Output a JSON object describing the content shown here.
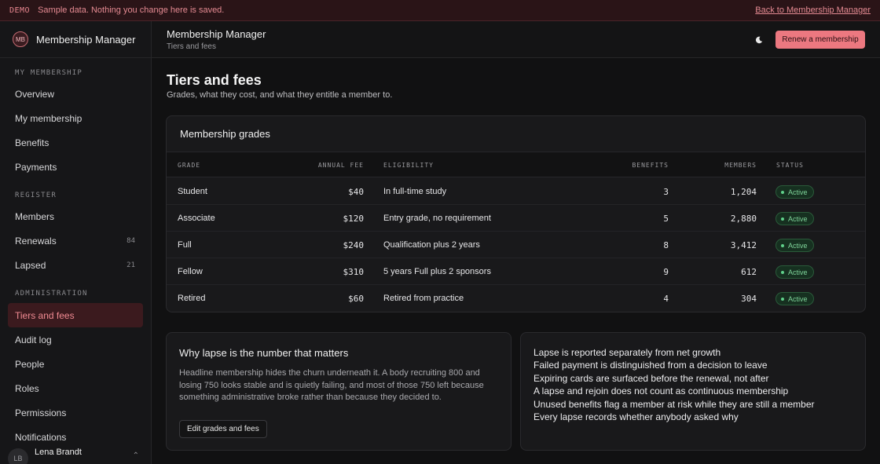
{
  "banner": {
    "tag": "DEMO",
    "message": "Sample data. Nothing you change here is saved.",
    "back_link": "Back to Membership Manager"
  },
  "sidebar": {
    "logo_initials": "MB",
    "app_name": "Membership Manager",
    "sections": [
      {
        "label": "MY MEMBERSHIP",
        "items": [
          {
            "label": "Overview"
          },
          {
            "label": "My membership"
          },
          {
            "label": "Benefits"
          },
          {
            "label": "Payments"
          }
        ]
      },
      {
        "label": "REGISTER",
        "items": [
          {
            "label": "Members"
          },
          {
            "label": "Renewals",
            "count": "84"
          },
          {
            "label": "Lapsed",
            "count": "21"
          }
        ]
      },
      {
        "label": "ADMINISTRATION",
        "items": [
          {
            "label": "Tiers and fees",
            "active": true
          },
          {
            "label": "Audit log"
          },
          {
            "label": "People"
          },
          {
            "label": "Roles"
          },
          {
            "label": "Permissions"
          },
          {
            "label": "Notifications"
          }
        ]
      }
    ],
    "user": {
      "initials": "LB",
      "name": "Lena Brandt"
    }
  },
  "header": {
    "title": "Membership Manager",
    "subtitle": "Tiers and fees",
    "theme_icon": "moon-icon",
    "renew_label": "Renew a membership"
  },
  "page": {
    "title": "Tiers and fees",
    "subtitle": "Grades, what they cost, and what they entitle a member to."
  },
  "grades": {
    "title": "Membership grades",
    "columns": [
      "GRADE",
      "ANNUAL FEE",
      "ELIGIBILITY",
      "BENEFITS",
      "MEMBERS",
      "STATUS"
    ],
    "rows": [
      {
        "grade": "Student",
        "fee": "$40",
        "eligibility": "In full-time study",
        "benefits": "3",
        "members": "1,204",
        "status": "Active"
      },
      {
        "grade": "Associate",
        "fee": "$120",
        "eligibility": "Entry grade, no requirement",
        "benefits": "5",
        "members": "2,880",
        "status": "Active"
      },
      {
        "grade": "Full",
        "fee": "$240",
        "eligibility": "Qualification plus 2 years",
        "benefits": "8",
        "members": "3,412",
        "status": "Active"
      },
      {
        "grade": "Fellow",
        "fee": "$310",
        "eligibility": "5 years Full plus 2 sponsors",
        "benefits": "9",
        "members": "612",
        "status": "Active"
      },
      {
        "grade": "Retired",
        "fee": "$60",
        "eligibility": "Retired from practice",
        "benefits": "4",
        "members": "304",
        "status": "Active"
      }
    ]
  },
  "lapse": {
    "title": "Why lapse is the number that matters",
    "body": "Headline membership hides the churn underneath it. A body recruiting 800 and losing 750 looks stable and is quietly failing, and most of those 750 left because something administrative broke rather than because they decided to.",
    "edit_label": "Edit grades and fees"
  },
  "points": [
    "Lapse is reported separately from net growth",
    "Failed payment is distinguished from a decision to leave",
    "Expiring cards are surfaced before the renewal, not after",
    "A lapse and rejoin does not count as continuous membership",
    "Unused benefits flag a member at risk while they are still a member",
    "Every lapse records whether anybody asked why"
  ],
  "colors": {
    "accent": "#ec7880",
    "active_nav_bg": "#3b1a1e",
    "status_active": "#7fd59a"
  }
}
